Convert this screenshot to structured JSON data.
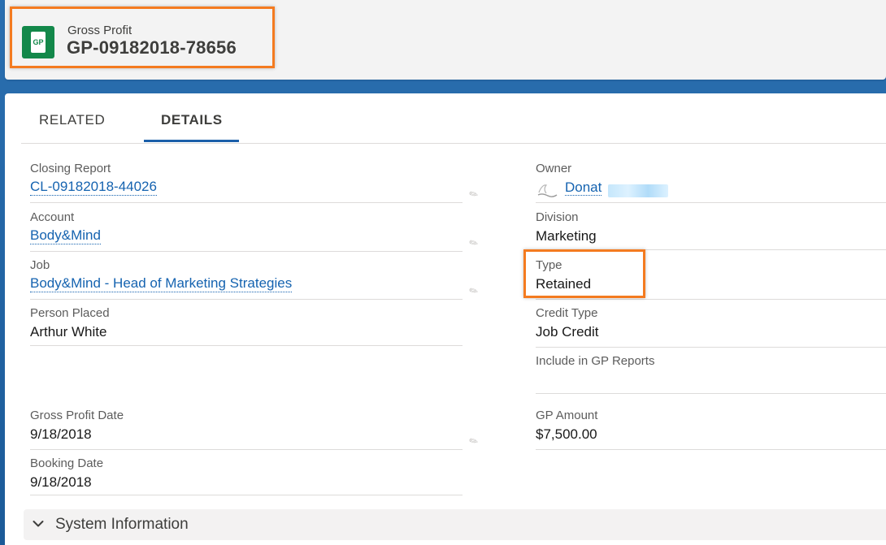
{
  "header": {
    "object_label": "Gross Profit",
    "record_name": "GP-09182018-78656",
    "icon": "gross-profit-icon",
    "icon_text": "GP"
  },
  "tabs": [
    {
      "label": "RELATED",
      "active": false
    },
    {
      "label": "DETAILS",
      "active": true
    }
  ],
  "fields_left": [
    {
      "label": "Closing Report",
      "value": "CL-09182018-44026",
      "link": true,
      "editable": true
    },
    {
      "label": "Account",
      "value": "Body&Mind",
      "link": true,
      "editable": true
    },
    {
      "label": "Job",
      "value": "Body&Mind - Head of Marketing Strategies",
      "link": true,
      "editable": true
    },
    {
      "label": "Person Placed",
      "value": "Arthur White",
      "link": false,
      "editable": false
    },
    {
      "label": "Gross Profit Date",
      "value": "9/18/2018",
      "link": false,
      "editable": true
    },
    {
      "label": "Booking Date",
      "value": "9/18/2018",
      "link": false,
      "editable": false
    }
  ],
  "fields_right": [
    {
      "label": "Owner",
      "value": "Donat",
      "link": true
    },
    {
      "label": "Division",
      "value": "Marketing",
      "link": false
    },
    {
      "label": "Type",
      "value": "Retained",
      "link": false
    },
    {
      "label": "Credit Type",
      "value": "Job Credit",
      "link": false
    },
    {
      "label": "Include in GP Reports",
      "value": "",
      "link": false
    },
    {
      "label": "GP Amount",
      "value": "$7,500.00",
      "link": false
    }
  ],
  "section": {
    "title": "System Information",
    "icon": "chevron-down-icon"
  },
  "colors": {
    "accent": "#1563b0",
    "highlight": "#f47b20",
    "icon_bg": "#13884a"
  }
}
